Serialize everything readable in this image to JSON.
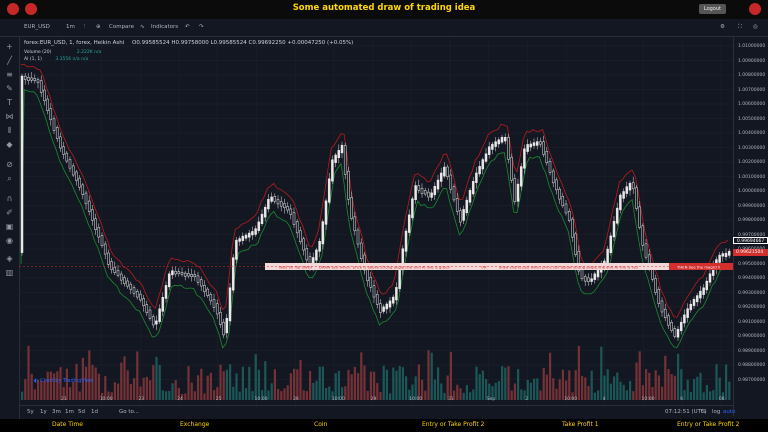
{
  "app": {
    "title": "Some automated draw of trading idea",
    "logout_label": "Logout"
  },
  "toolbar": {
    "symbol": "EUR_USD",
    "interval": "1m",
    "compare": "Compare",
    "indicators": "Indicators"
  },
  "legend": {
    "main": "forex:EUR_USD, 1, forex, Heikin Ashi",
    "ohlc": "O0.99585524  H0.99758000  L0.99585524  C0.99692250  +0.00047250 (+0.05%)",
    "volume_label": "Volume (20)",
    "volume_value": "2.222K  n/a",
    "ai_label": "AI (1, 1)",
    "ai_value": "3.3556  n/a  n/a"
  },
  "price_axis": {
    "ticks": [
      "1.01000000",
      "1.00900000",
      "1.00800000",
      "1.00700000",
      "1.00600000",
      "1.00500000",
      "1.00400000",
      "1.00300000",
      "1.00200000",
      "1.00100000",
      "1.00000000",
      "0.99900000",
      "0.99800000",
      "0.99700000",
      "0.99600000",
      "0.99500000",
      "0.99400000",
      "0.99300000",
      "0.99200000",
      "0.99100000",
      "0.99000000",
      "0.98900000",
      "0.98800000",
      "0.98700000"
    ],
    "last_price": "0.99694667",
    "marker_price": "0.99621504"
  },
  "time_axis": {
    "ticks": [
      "21",
      "10:00",
      "23",
      "24",
      "25",
      "10:00",
      "26",
      "10:00",
      "29",
      "10:00",
      "31",
      "Sep",
      "2",
      "10:00",
      "4",
      "10:00",
      "6",
      "08"
    ]
  },
  "annotation": {
    "parts": [
      "Wait till flip SWDI",
      "DRAW just when:   price is above strong angle line and AI line is green",
      "OR",
      "draw shorts just when price still below strong angle line and AI line is red",
      "THEN See the magic!!!"
    ]
  },
  "attribution": "Chart by TradingView",
  "bottom_bar": {
    "ranges": [
      "5y",
      "1y",
      "3m",
      "1m",
      "5d",
      "1d"
    ],
    "goto": "Go to...",
    "time": "07:12:51 (UTC)",
    "pct": "%",
    "log": "log",
    "auto": "auto"
  },
  "footer": {
    "items": [
      "Date Time",
      "Exchange",
      "Coin",
      "Entry or Take Profit 2",
      "Take Profit 1",
      "Entry or Take Profit 2"
    ]
  },
  "colors": {
    "title": "#ffd700",
    "bg": "#131722",
    "up": "#26a69a",
    "down": "#ef5350",
    "annotation_bg": "#f2d8d8",
    "annotation_text": "#d32f2f"
  }
}
